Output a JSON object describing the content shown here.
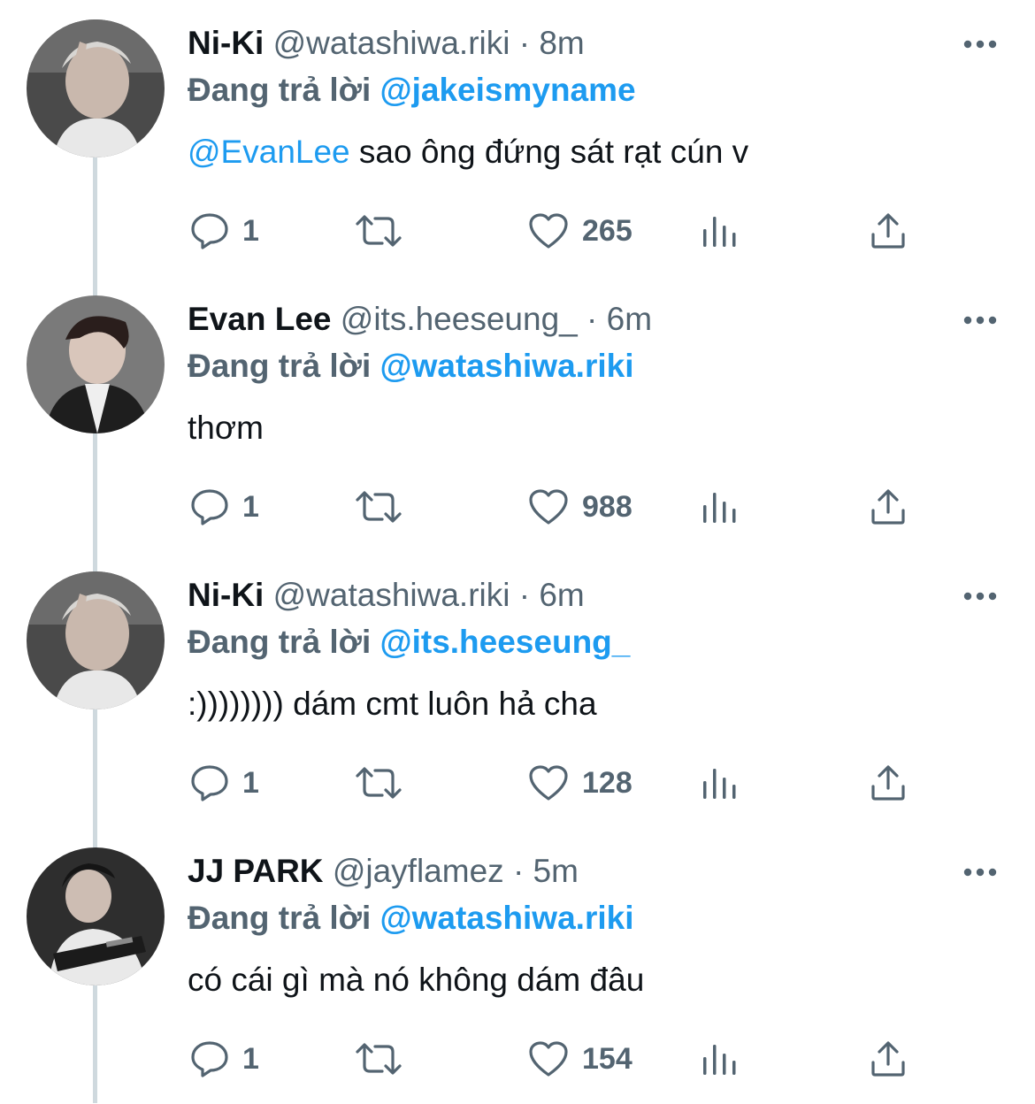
{
  "tweets": [
    {
      "name": "Ni-Ki",
      "handle": "@watashiwa.riki",
      "separator": "·",
      "time": "8m",
      "replying_label": "Đang trả lời",
      "replying_to": "@jakeismyname",
      "mention": "@EvanLee",
      "text": " sao ông đứng sát rạt cún v",
      "reply_count": "1",
      "like_count": "265",
      "avatar_bg": "#5b5b5b"
    },
    {
      "name": "Evan Lee",
      "handle": "@its.heeseung_",
      "separator": "·",
      "time": "6m",
      "replying_label": "Đang trả lời",
      "replying_to": "@watashiwa.riki",
      "mention": "",
      "text": "thơm",
      "reply_count": "1",
      "like_count": "988",
      "avatar_bg": "#6e6e6e"
    },
    {
      "name": "Ni-Ki",
      "handle": "@watashiwa.riki",
      "separator": "·",
      "time": "6m",
      "replying_label": "Đang trả lời",
      "replying_to": "@its.heeseung_",
      "mention": "",
      "text": ":)))))))) dám cmt luôn hả cha",
      "reply_count": "1",
      "like_count": "128",
      "avatar_bg": "#5b5b5b"
    },
    {
      "name": "JJ PARK",
      "handle": "@jayflamez",
      "separator": "·",
      "time": "5m",
      "replying_label": "Đang trả lời",
      "replying_to": "@watashiwa.riki",
      "mention": "",
      "text": "có cái gì mà nó không dám đâu",
      "reply_count": "1",
      "like_count": "154",
      "avatar_bg": "#3a3a3a"
    }
  ],
  "icons": {
    "reply": "comment-bubble-icon",
    "retweet": "retweet-icon",
    "like": "heart-icon",
    "views": "analytics-bars-icon",
    "share": "share-upload-icon",
    "more": "more-dots-icon"
  },
  "colors": {
    "accent": "#1d9bf0",
    "secondary_text": "#536471",
    "thread_line": "#cfd9de"
  }
}
